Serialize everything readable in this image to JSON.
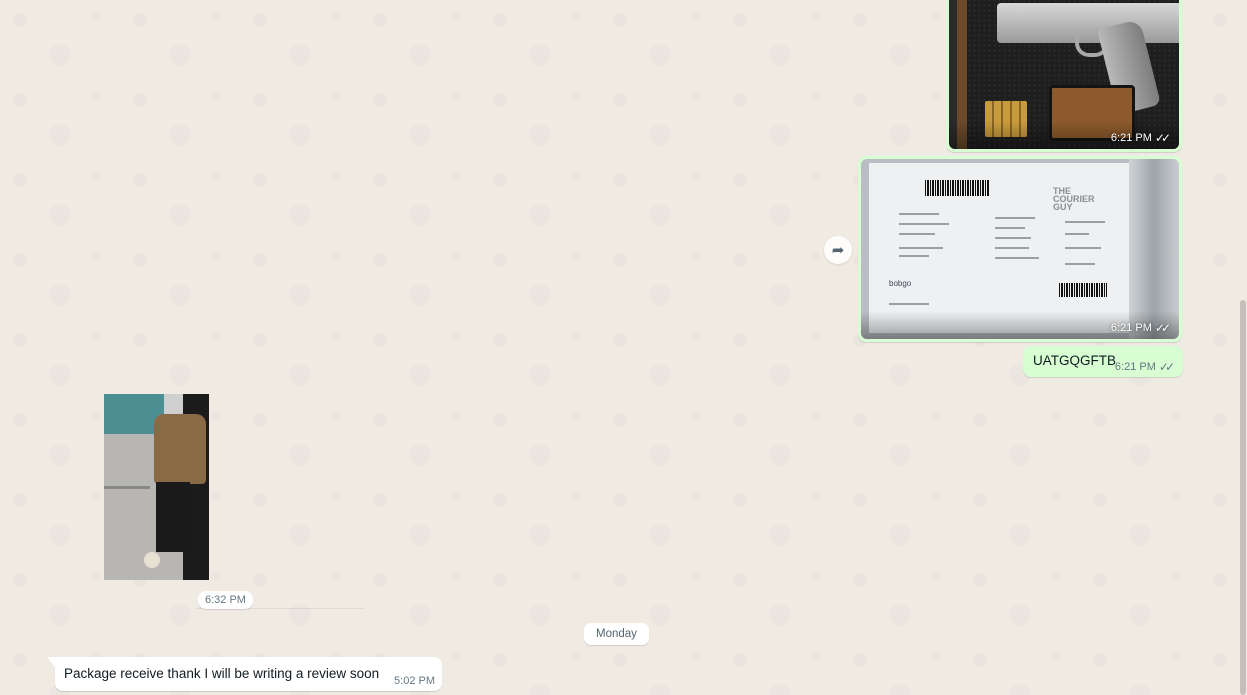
{
  "messages": {
    "gun_photo": {
      "time": "6:21 PM",
      "status_icon": "double-check-icon"
    },
    "label_photo": {
      "time": "6:21 PM",
      "status_icon": "double-check-icon",
      "brand_text": "THE COURIER GUY",
      "logo_text": "bobgo"
    },
    "text_out": {
      "text": "UATGQGFTB",
      "time": "6:21 PM",
      "status_icon": "double-check-icon"
    },
    "video_in": {
      "time": "6:32 PM"
    },
    "day_separator": "Monday",
    "text_in": {
      "text": "Package receive thank I will be writing a review soon",
      "time": "5:02 PM"
    }
  },
  "icons": {
    "forward": "forward-icon",
    "ticks": "✓✓",
    "forward_glyph": "➦"
  },
  "colors": {
    "outgoing_bubble": "#d9fdd3",
    "incoming_bubble": "#ffffff",
    "background": "#efeae2"
  }
}
